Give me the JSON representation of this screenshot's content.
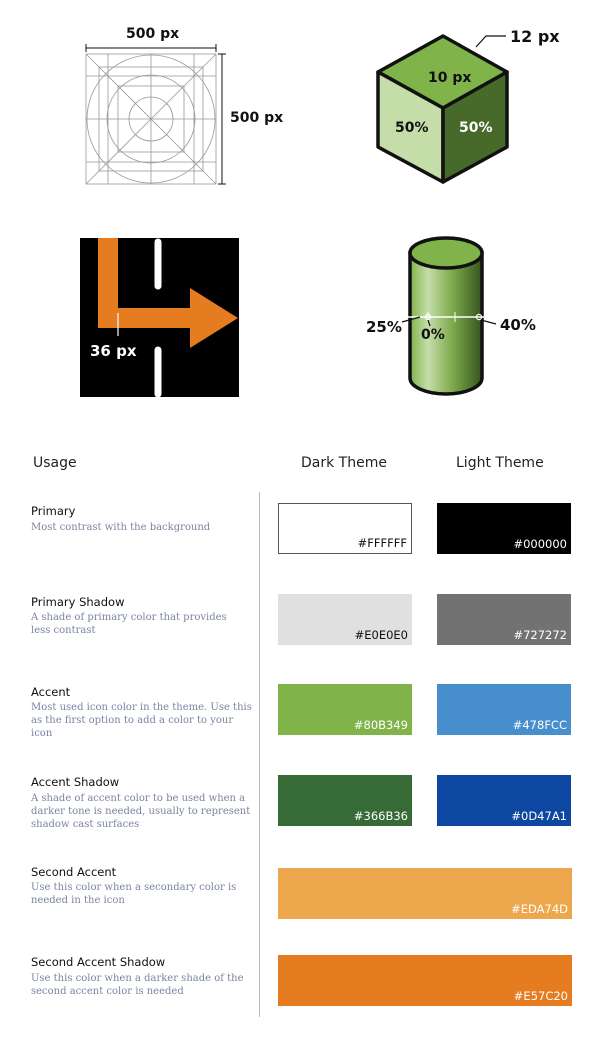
{
  "figures": {
    "grid": {
      "width_label": "500 px",
      "height_label": "500 px"
    },
    "cube": {
      "stroke_label": "12 px",
      "inner_label": "10 px",
      "left_face": "50%",
      "right_face": "50%"
    },
    "arrow": {
      "stroke_label": "36 px"
    },
    "cylinder": {
      "left_label": "25%",
      "center_label": "0%",
      "right_label": "40%"
    }
  },
  "table": {
    "headers": {
      "usage": "Usage",
      "dark": "Dark Theme",
      "light": "Light Theme"
    },
    "rows": [
      {
        "title": "Primary",
        "desc": "Most contrast with the background",
        "dark": {
          "hex": "#FFFFFF",
          "color": "#FFFFFF"
        },
        "light": {
          "hex": "#000000",
          "color": "#000000"
        }
      },
      {
        "title": "Primary Shadow",
        "desc": "A shade of primary color that provides less contrast",
        "dark": {
          "hex": "#E0E0E0",
          "color": "#E0E0E0"
        },
        "light": {
          "hex": "#727272",
          "color": "#727272"
        }
      },
      {
        "title": "Accent",
        "desc": "Most used icon color in the theme. Use this as the first option to add a color to your icon",
        "dark": {
          "hex": "#80B349",
          "color": "#80B349"
        },
        "light": {
          "hex": "#478FCC",
          "color": "#478FCC"
        }
      },
      {
        "title": "Accent Shadow",
        "desc": "A shade of accent color to be used when a darker tone is needed, usually to represent shadow cast surfaces",
        "dark": {
          "hex": "#366B36",
          "color": "#366B36"
        },
        "light": {
          "hex": "#0D47A1",
          "color": "#0D47A1"
        }
      },
      {
        "title": "Second Accent",
        "desc": "Use this color when a secondary color is needed in the icon",
        "wide": {
          "hex": "#EDA74D",
          "color": "#EDA74D"
        }
      },
      {
        "title": "Second Accent Shadow",
        "desc": "Use this color when a darker shade of the second accent color is needed",
        "wide": {
          "hex": "#E57C20",
          "color": "#E57C20"
        }
      }
    ]
  }
}
